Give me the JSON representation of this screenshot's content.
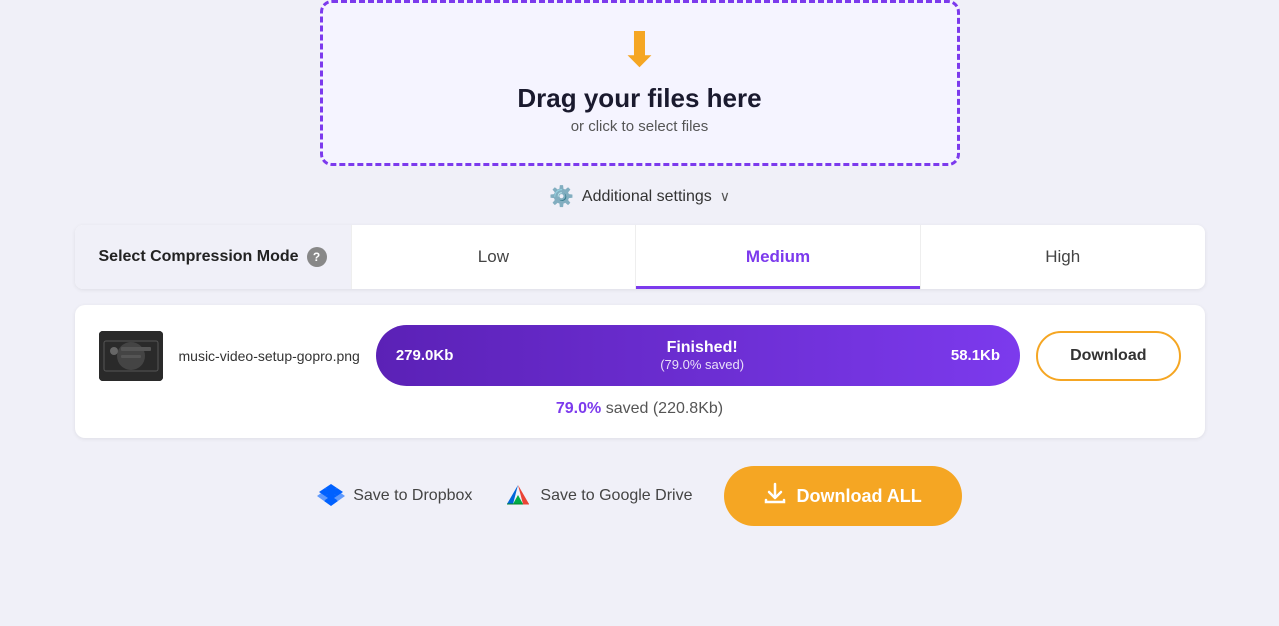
{
  "dropzone": {
    "title": "Drag your files here",
    "subtitle": "or click to select files"
  },
  "settings": {
    "label": "Additional settings",
    "chevron": "∨"
  },
  "compression": {
    "label": "Select Compression Mode",
    "help": "?",
    "options": [
      {
        "id": "low",
        "label": "Low",
        "active": false
      },
      {
        "id": "medium",
        "label": "Medium",
        "active": true
      },
      {
        "id": "high",
        "label": "High",
        "active": false
      }
    ]
  },
  "file": {
    "name": "music-video-setup-gopro.png",
    "original_size": "279.0Kb",
    "compressed_size": "58.1Kb",
    "status": "Finished!",
    "saved_pct_bar": "(79.0% saved)",
    "savings_text": "79.0% saved (220.8Kb)",
    "savings_pct": "79.0%",
    "savings_suffix": " saved (220.8Kb)"
  },
  "buttons": {
    "download": "Download",
    "save_dropbox": "Save to Dropbox",
    "save_drive": "Save to Google Drive",
    "download_all": "Download ALL"
  }
}
